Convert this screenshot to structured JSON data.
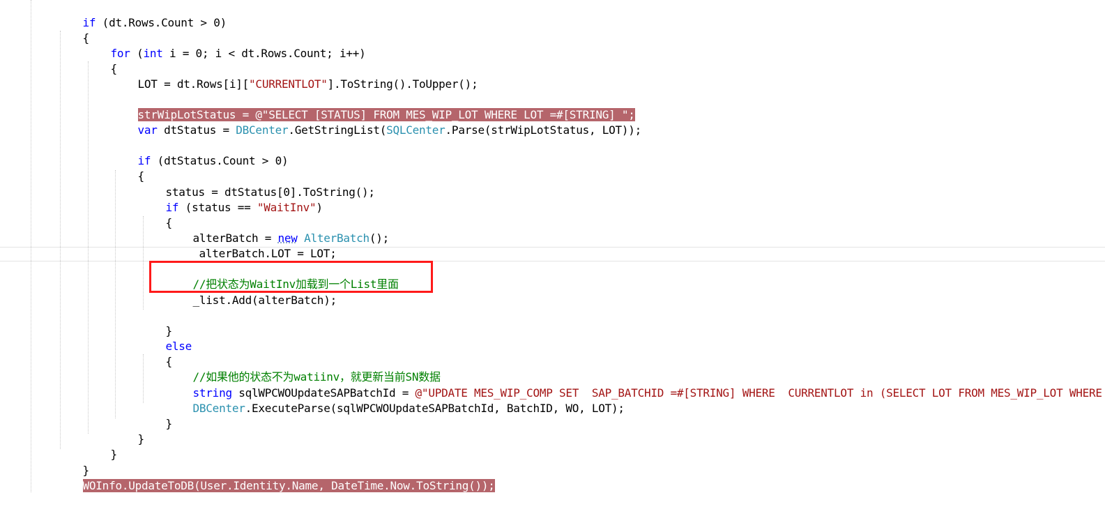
{
  "code": {
    "l01": {
      "a": "if",
      "b": " (dt.Rows.Count > 0)"
    },
    "l02": {
      "a": "{"
    },
    "l03": {
      "a": "for",
      "b": " (",
      "c": "int",
      "d": " i = 0; i < dt.Rows.Count; i++)"
    },
    "l04": {
      "a": "{"
    },
    "l05": {
      "a": "LOT = dt.Rows[i][",
      "b": "\"CURRENTLOT\"",
      "c": "].ToString().ToUpper();"
    },
    "l06": {
      "a": "strWipLotStatus = ",
      "b": "@\"SELECT [STATUS] FROM MES_WIP_LOT WHERE LOT =#[STRING] \"",
      "c": ";"
    },
    "l07": {
      "a": "var",
      "b": " dtStatus = ",
      "c": "DBCenter",
      "d": ".GetStringList(",
      "e": "SQLCenter",
      "f": ".Parse(strWipLotStatus, LOT));"
    },
    "l08": {
      "a": "if",
      "b": " (dtStatus.Count > 0)"
    },
    "l09": {
      "a": "{"
    },
    "l10": {
      "a": "status = dtStatus[0].ToString();"
    },
    "l11": {
      "a": "if",
      "b": " (status == ",
      "c": "\"WaitInv\"",
      "d": ")"
    },
    "l12": {
      "a": "{"
    },
    "l13": {
      "a": "alterBatch = ",
      "b": "new",
      "c": " ",
      "d": "AlterBatch",
      "e": "();"
    },
    "l14": {
      "a": "alterBatch.LOT = LOT;"
    },
    "l15": {
      "a": "//把状态为WaitInv加载到一个List里面"
    },
    "l16": {
      "a": "_list.Add(alterBatch);"
    },
    "l17": {
      "a": "}"
    },
    "l18": {
      "a": "else"
    },
    "l19": {
      "a": "{"
    },
    "l20": {
      "a": "//如果他的状态不为watiinv，就更新当前SN数据"
    },
    "l21": {
      "a": "string",
      "b": " sqlWPCWOUpdateSAPBatchId = ",
      "c": "@\"UPDATE MES_WIP_COMP SET  SAP_BATCHID =#[STRING] WHERE  CURRENTLOT in (SELECT LOT FROM MES_WIP_LOT WHERE"
    },
    "l22": {
      "a": "DBCenter",
      "b": ".ExecuteParse(sqlWPCWOUpdateSAPBatchId, BatchID, WO, LOT);"
    },
    "l23": {
      "a": "}"
    },
    "l24": {
      "a": "}"
    },
    "l25": {
      "a": "}"
    },
    "l26": {
      "a": "}"
    },
    "l27": {
      "a": "WOInfo.UpdateToDB(User.Identity.Name, DateTime.Now.ToString());"
    }
  },
  "colors": {
    "keyword": "#0000ff",
    "type": "#2b91af",
    "string": "#a31515",
    "comment": "#008000",
    "highlight": "#b5656b",
    "annotation_box": "#ff1a1a"
  }
}
